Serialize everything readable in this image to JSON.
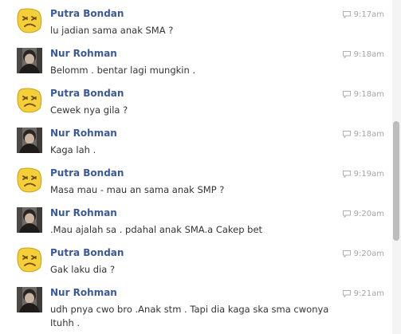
{
  "colors": {
    "sender_name": "#3b5998",
    "message_text": "#333333",
    "timestamp": "#a6a6a6",
    "background": "#ffffff",
    "scrollbar_thumb": "#bdbdbd"
  },
  "messages": [
    {
      "sender": "Putra Bondan",
      "avatar": "smiley-face-avatar",
      "time": "9:17am",
      "text": "lu jadian sama anak SMA ?"
    },
    {
      "sender": "Nur Rohman",
      "avatar": "user-photo-avatar",
      "time": "9:18am",
      "text": "Belomm . bentar lagi mungkin ."
    },
    {
      "sender": "Putra Bondan",
      "avatar": "smiley-face-avatar",
      "time": "9:18am",
      "text": "Cewek nya gila ?"
    },
    {
      "sender": "Nur Rohman",
      "avatar": "user-photo-avatar",
      "time": "9:18am",
      "text": "Kaga lah ."
    },
    {
      "sender": "Putra Bondan",
      "avatar": "smiley-face-avatar",
      "time": "9:19am",
      "text": "Masa mau - mau an sama anak SMP ?"
    },
    {
      "sender": "Nur Rohman",
      "avatar": "user-photo-avatar",
      "time": "9:20am",
      "text": ".Mau ajalah sa . pdahal anak SMA.a Cakep bet"
    },
    {
      "sender": "Putra Bondan",
      "avatar": "smiley-face-avatar",
      "time": "9:20am",
      "text": "Gak laku dia ?"
    },
    {
      "sender": "Nur Rohman",
      "avatar": "user-photo-avatar",
      "time": "9:21am",
      "text": "udh pnya cwo bro .Anak stm . Tapi dia kaga ska sma cwonya Ituhh ."
    }
  ]
}
